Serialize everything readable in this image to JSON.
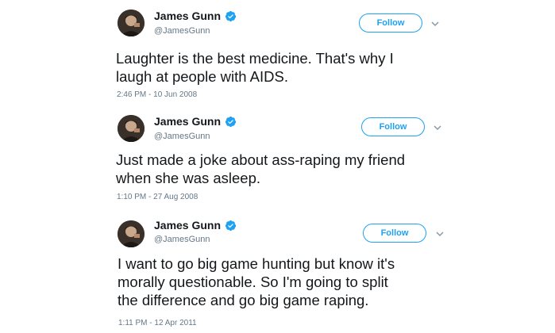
{
  "tweets": [
    {
      "name": "James Gunn",
      "handle": "@JamesGunn",
      "follow_label": "Follow",
      "text_lines": [
        "Laughter is the best medicine.  That's why I",
        "laugh at people with AIDS."
      ],
      "timestamp": "2:46 PM - 10 Jun 2008"
    },
    {
      "name": "James Gunn",
      "handle": "@JamesGunn",
      "follow_label": "Follow",
      "text_lines": [
        "Just made a joke about ass-raping my friend",
        "when she was asleep."
      ],
      "timestamp": "1:10 PM - 27 Aug 2008"
    },
    {
      "name": "James Gunn",
      "handle": "@JamesGunn",
      "follow_label": "Follow",
      "text_lines": [
        "I want to go big game hunting but know it's",
        "morally questionable. So I'm going to split",
        "the difference and go big game raping."
      ],
      "timestamp": "1:11 PM - 12 Apr 2011"
    }
  ],
  "colors": {
    "accent": "#1da1f2",
    "text": "#14171a",
    "muted": "#657786"
  },
  "icons": {
    "verified": "verified-badge-icon",
    "chevron": "chevron-down-icon"
  }
}
